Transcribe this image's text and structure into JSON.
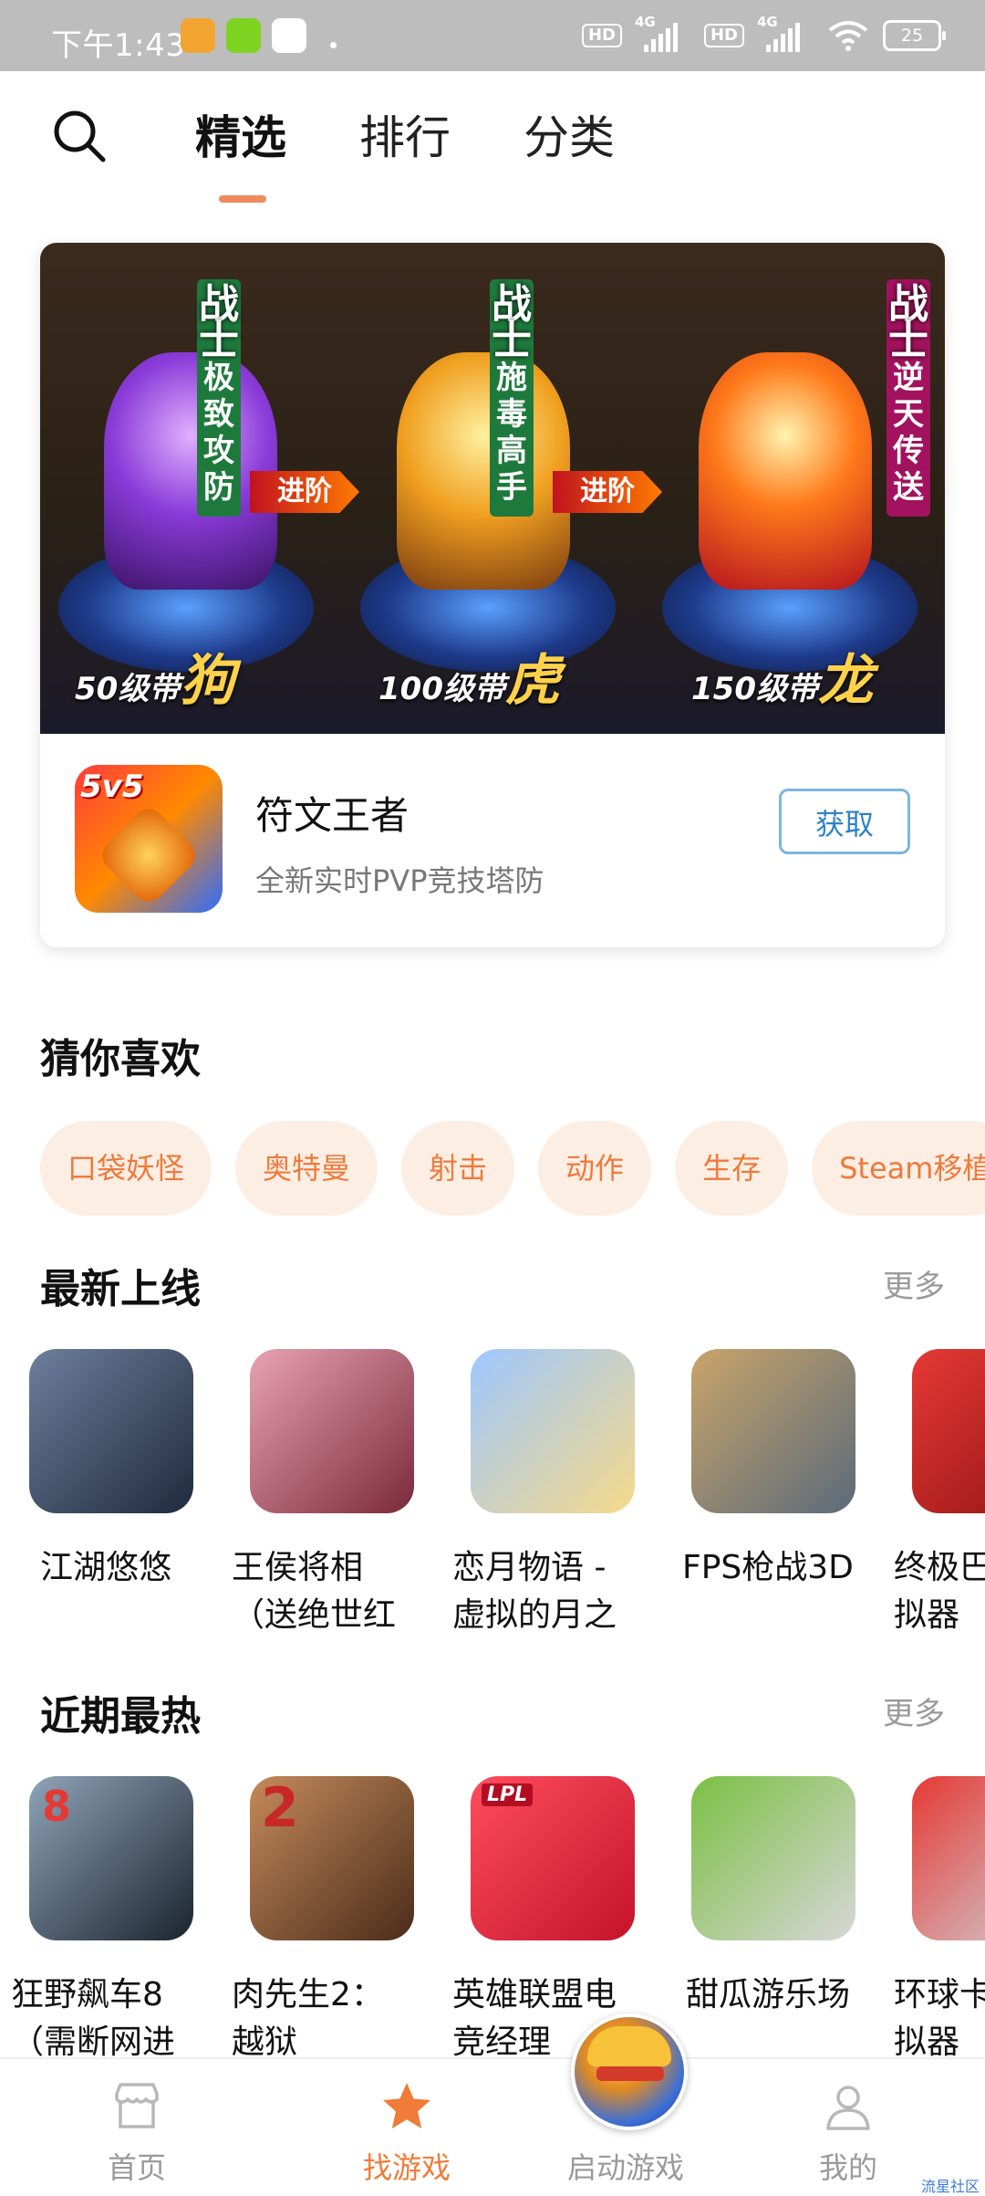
{
  "status_bar": {
    "time": "下午1:43",
    "network_1": "4G",
    "network_2": "4G",
    "hd": "HD",
    "battery": "25"
  },
  "top_tabs": [
    {
      "label": "精选",
      "active": true
    },
    {
      "label": "排行",
      "active": false
    },
    {
      "label": "分类",
      "active": false
    }
  ],
  "featured": {
    "banner": {
      "columns": [
        {
          "class_tag": "战士",
          "tag": "极致攻防",
          "level_text": "50级带",
          "pet": "狗"
        },
        {
          "class_tag": "战士",
          "tag": "施毒高手",
          "level_text": "100级带",
          "pet": "虎"
        },
        {
          "class_tag": "战士",
          "tag": "逆天传送",
          "level_text": "150级带",
          "pet": "龙"
        }
      ],
      "arrow_label": "进阶"
    },
    "game_title": "符文王者",
    "game_subtitle": "全新实时PVP竞技塔防",
    "icon_text": "5v5",
    "get_button": "获取"
  },
  "guess_you_like": {
    "title": "猜你喜欢",
    "chips": [
      "口袋妖怪",
      "奥特曼",
      "射击",
      "动作",
      "生存",
      "Steam移植"
    ]
  },
  "new_releases": {
    "title": "最新上线",
    "more": "更多",
    "games": [
      {
        "name": "江湖悠悠",
        "colors": [
          "#6d7f9c",
          "#1f2a3d"
        ]
      },
      {
        "name": "王侯将相（送绝世红",
        "colors": [
          "#e8a3b3",
          "#7a2a3a"
        ]
      },
      {
        "name": "恋月物语 - 虚拟的月之",
        "colors": [
          "#9ec7ff",
          "#f6d98a"
        ]
      },
      {
        "name": "FPS枪战3D",
        "colors": [
          "#c9a46a",
          "#5b6a7a"
        ]
      },
      {
        "name": "终极巴士模拟器",
        "colors": [
          "#e53935",
          "#8e1212"
        ]
      }
    ]
  },
  "hot_recent": {
    "title": "近期最热",
    "more": "更多",
    "games": [
      {
        "name": "狂野飙车8（需断网进",
        "colors": [
          "#8fa3b8",
          "#1b2430"
        ],
        "badge": "8"
      },
      {
        "name": "肉先生2：越狱",
        "colors": [
          "#c58a5a",
          "#4a2c1a"
        ],
        "badge": "2"
      },
      {
        "name": "英雄联盟电竞经理",
        "colors": [
          "#ff4d5e",
          "#c4122a"
        ],
        "badge": "LPL"
      },
      {
        "name": "甜瓜游乐场",
        "colors": [
          "#7bc043",
          "#d7d7d7"
        ]
      },
      {
        "name": "环球卡车模拟器",
        "colors": [
          "#e53935",
          "#cfd8dc"
        ]
      }
    ]
  },
  "bottom_nav": [
    {
      "label": "首页",
      "active": false
    },
    {
      "label": "找游戏",
      "active": true
    },
    {
      "label": "启动游戏",
      "active": false
    },
    {
      "label": "我的",
      "active": false
    }
  ],
  "watermark": "流星社区"
}
